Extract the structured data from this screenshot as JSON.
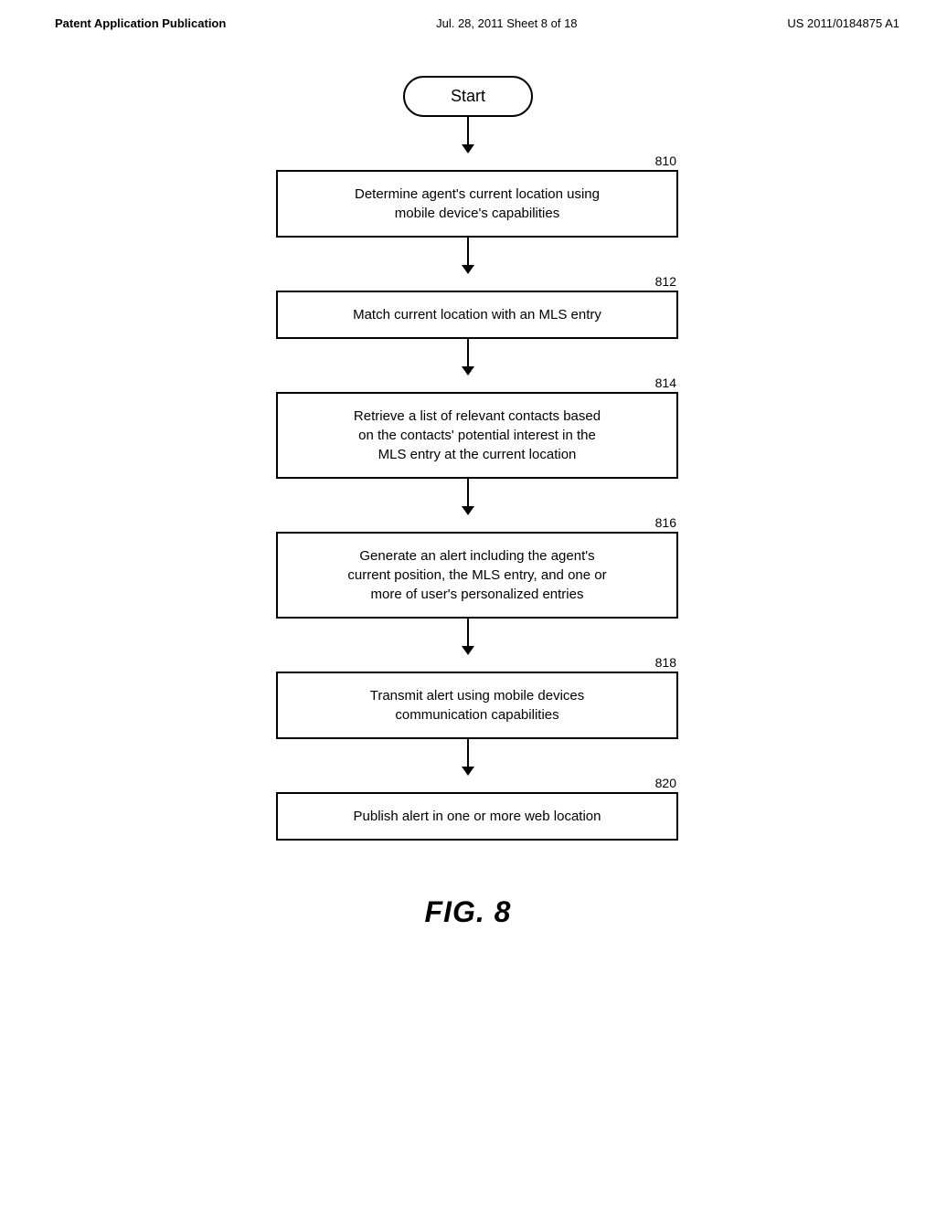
{
  "header": {
    "left": "Patent Application Publication",
    "center": "Jul. 28, 2011  Sheet 8 of 18",
    "right": "US 2011/0184875 A1"
  },
  "diagram": {
    "start_label": "Start",
    "steps": [
      {
        "number": "810",
        "text": "Determine agent's current location using mobile device's capabilities"
      },
      {
        "number": "812",
        "text": "Match current location with an MLS entry"
      },
      {
        "number": "814",
        "text": "Retrieve a list of relevant contacts based on the contacts' potential interest in the MLS entry at the current location"
      },
      {
        "number": "816",
        "text": "Generate an alert including the agent's current position, the MLS entry, and one or more of user's personalized entries"
      },
      {
        "number": "818",
        "text": "Transmit alert using mobile devices communication capabilities"
      },
      {
        "number": "820",
        "text": "Publish alert in one or more web location"
      }
    ]
  },
  "figure_label": "FIG. 8",
  "arrow_heights": [
    30,
    30,
    30,
    30,
    30,
    30,
    30
  ]
}
